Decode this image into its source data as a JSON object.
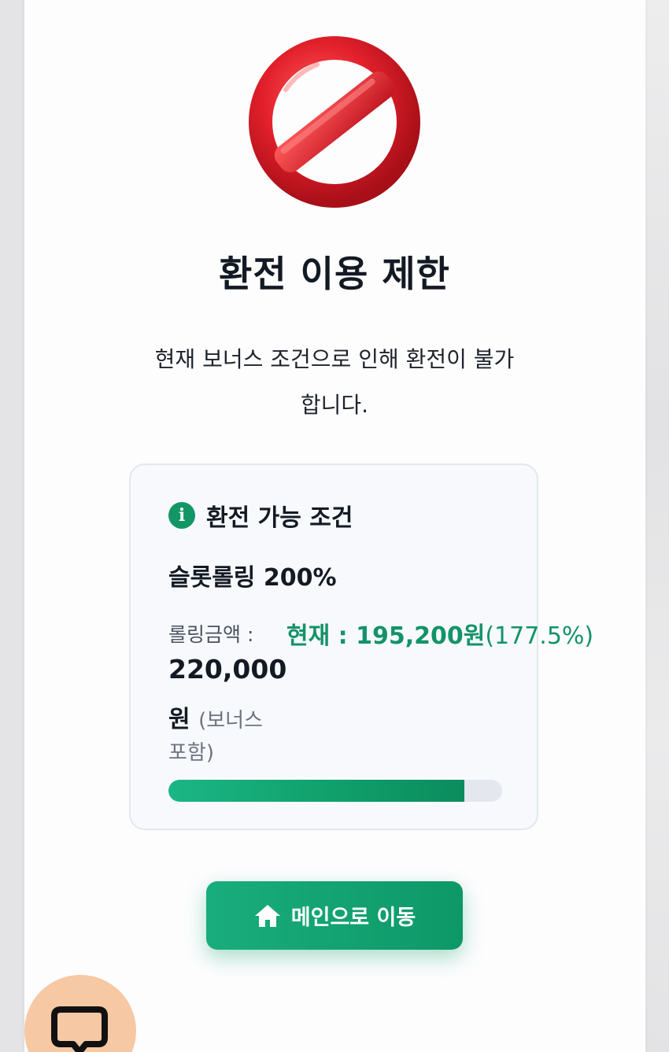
{
  "dialog": {
    "icon": "prohibited-icon",
    "title": "환전 이용 제한",
    "message_line1": "현재 보너스 조건으로 인해 환전이 불가",
    "message_line2": "합니다."
  },
  "conditions": {
    "icon": "info-icon",
    "info_glyph": "i",
    "title": "환전 가능 조건",
    "name": "슬롯롤링 200%",
    "rolling_label": "롤링금액 :",
    "rolling_amount": "220,000",
    "won_unit": "원",
    "bonus_note_1": "(보너스",
    "bonus_note_2": "포함)",
    "current_label": "현재 : 195,200원",
    "current_percent": "(177.5%)",
    "progress_fraction": 0.8875,
    "accent_color": "#129665"
  },
  "actions": {
    "home_icon": "home-icon",
    "home_label": "메인으로 이동"
  },
  "chat": {
    "icon": "chat-bubble-icon"
  }
}
